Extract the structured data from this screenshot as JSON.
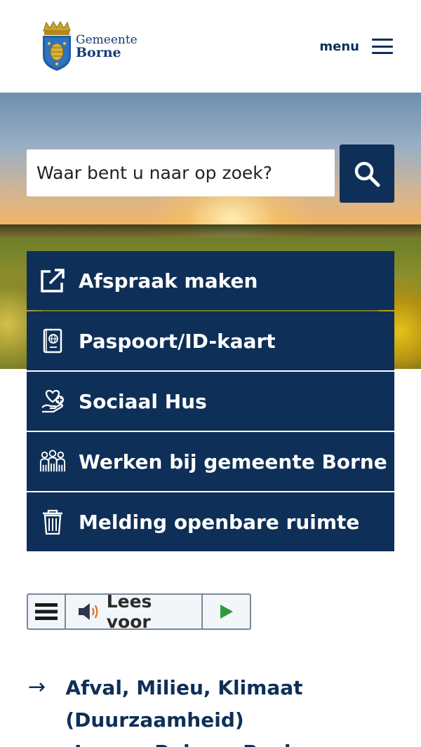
{
  "header": {
    "logo_line1": "Gemeente",
    "logo_line2": "Borne",
    "menu_label": "menu"
  },
  "search": {
    "placeholder": "Waar bent u naar op zoek?"
  },
  "quick_links": [
    {
      "label": "Afspraak maken",
      "icon": "external-link-icon"
    },
    {
      "label": "Paspoort/ID-kaart",
      "icon": "passport-icon"
    },
    {
      "label": "Sociaal Hus",
      "icon": "heart-hand-icon"
    },
    {
      "label": "Werken bij gemeente Borne",
      "icon": "people-icon"
    },
    {
      "label": "Melding openbare ruimte",
      "icon": "trash-can-icon"
    }
  ],
  "read_aloud": {
    "label": "Lees voor"
  },
  "topics": [
    {
      "label": "Afval, Milieu, Klimaat (Duurzaamheid)"
    },
    {
      "label": "Leven, Reizen, Papieren"
    }
  ],
  "colors": {
    "brand_navy": "#0e2f57",
    "logo_blue": "#143d74",
    "crest_gold": "#c9a227",
    "play_green": "#2e9a3c"
  }
}
